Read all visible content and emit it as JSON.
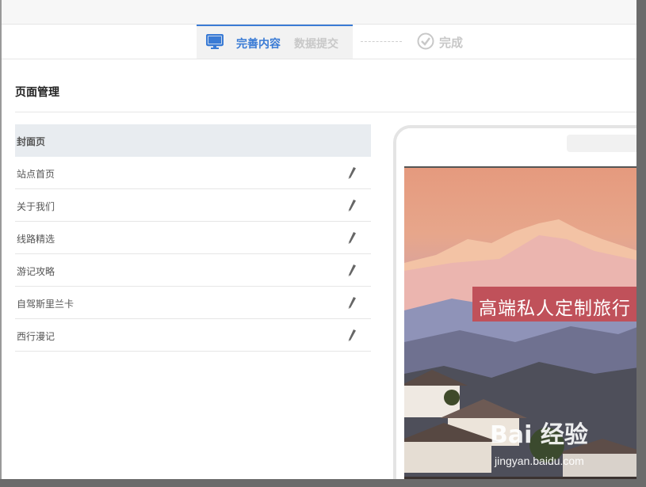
{
  "steps": {
    "step1": "完善内容",
    "step2": "数据提交",
    "step3": "完成",
    "active_color": "#3a7bd5",
    "inactive_color": "#c8c8c8"
  },
  "page_manager": {
    "title": "页面管理",
    "items": [
      {
        "label": "封面页",
        "selected": true,
        "editable": false
      },
      {
        "label": "站点首页",
        "selected": false,
        "editable": true
      },
      {
        "label": "关于我们",
        "selected": false,
        "editable": true
      },
      {
        "label": "线路精选",
        "selected": false,
        "editable": true
      },
      {
        "label": "游记攻略",
        "selected": false,
        "editable": true
      },
      {
        "label": "自驾斯里兰卡",
        "selected": false,
        "editable": true
      },
      {
        "label": "西行漫记",
        "selected": false,
        "editable": true
      }
    ]
  },
  "preview": {
    "banner_text": "高端私人定制旅行",
    "banner_color": "#c0515a"
  },
  "watermark": {
    "logo": "Bai 经验",
    "url": "jingyan.baidu.com"
  },
  "icons": {
    "step1": "monitor-icon",
    "step3": "check-circle-icon",
    "edit": "pencil-icon"
  }
}
